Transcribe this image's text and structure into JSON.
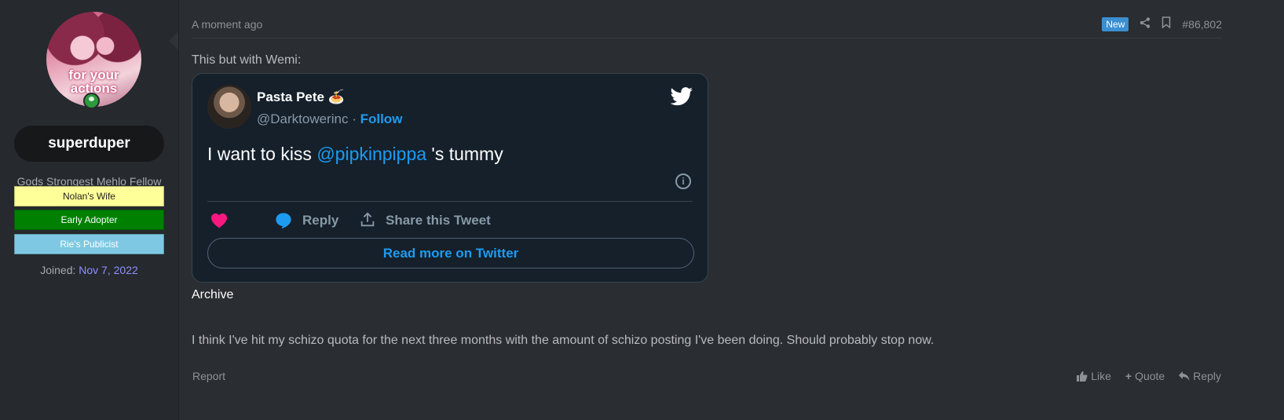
{
  "sidebar": {
    "avatar_text": "for your actions",
    "username": "superduper",
    "user_title": "Gods Strongest Mehlo Fellow",
    "banners": [
      {
        "label": "Nolan's Wife",
        "bg": "#ffff99",
        "fg": "#222222"
      },
      {
        "label": "Early Adopter",
        "bg": "#008000",
        "fg": "#ffffff"
      },
      {
        "label": "Rie's Publicist",
        "bg": "#7ec8e3",
        "fg": "#ffffff"
      }
    ],
    "joined_label": "Joined:",
    "joined_date": "Nov 7, 2022"
  },
  "post": {
    "timestamp": "A moment ago",
    "new_badge": "New",
    "post_number": "#86,802",
    "intro": "This but with Wemi:",
    "archive": "Archive",
    "body": "I think I've hit my schizo quota for the next three months with the amount of schizo posting I've been doing. Should probably stop now.",
    "report": "Report",
    "actions": {
      "like": "Like",
      "quote": "Quote",
      "reply": "Reply"
    }
  },
  "tweet": {
    "name": "Pasta Pete 🍝",
    "handle": "@Darktowerinc",
    "separator": "·",
    "follow": "Follow",
    "text_before": "I want to kiss ",
    "mention": "@pipkinpippa",
    "text_after": " 's tummy",
    "reply_label": "Reply",
    "share_label": "Share this Tweet",
    "read_more": "Read more on Twitter"
  },
  "colors": {
    "accent": "#1d9bf0",
    "new_badge": "#3b8fd1",
    "joined_date": "#8f8fff",
    "heart": "#f91880"
  },
  "icons": {
    "share": "share-icon",
    "bookmark": "bookmark-icon",
    "twitter": "twitter-bird-icon",
    "info": "info-icon",
    "heart": "heart-icon",
    "reply": "reply-bubble-icon",
    "upload": "share-upload-icon",
    "thumb": "thumbs-up-icon",
    "plus": "plus-icon",
    "reply_arrow": "reply-arrow-icon"
  }
}
